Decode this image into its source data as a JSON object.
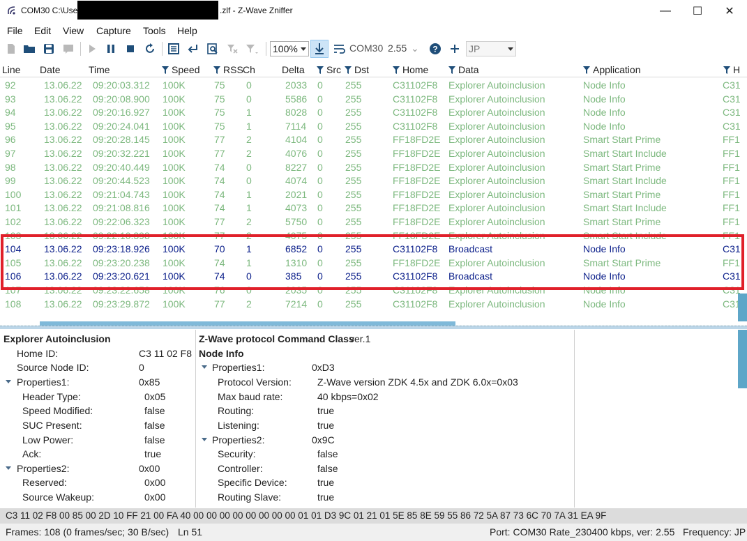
{
  "window": {
    "title_prefix": "COM30 C:\\User",
    "title_suffix": ".zlf - Z-Wave Zniffer",
    "minimize": "—",
    "maximize": "☐",
    "close": "✕"
  },
  "menu": [
    "File",
    "Edit",
    "View",
    "Capture",
    "Tools",
    "Help"
  ],
  "toolbar": {
    "zoom": "100%",
    "port": "COM30",
    "version": "2.55",
    "frequency": "JP",
    "help": "?",
    "add": "+"
  },
  "columns": [
    "Line",
    "Date",
    "Time",
    "Speed",
    "RSS",
    "Ch",
    "Delta",
    "Src",
    "Dst",
    "Home",
    "Data",
    "Application",
    "H"
  ],
  "rows": [
    {
      "line": "92",
      "date": "13.06.22",
      "time": "09:20:03.312",
      "speed": "100K",
      "rss": "75",
      "ch": "0",
      "delta": "2033",
      "src": "0",
      "dst": "255",
      "home": "C31102F8",
      "data": "Explorer Autoinclusion",
      "app": "Node Info",
      "h": "C31",
      "style": "dim"
    },
    {
      "line": "93",
      "date": "13.06.22",
      "time": "09:20:08.900",
      "speed": "100K",
      "rss": "75",
      "ch": "0",
      "delta": "5586",
      "src": "0",
      "dst": "255",
      "home": "C31102F8",
      "data": "Explorer Autoinclusion",
      "app": "Node Info",
      "h": "C31",
      "style": "dim"
    },
    {
      "line": "94",
      "date": "13.06.22",
      "time": "09:20:16.927",
      "speed": "100K",
      "rss": "75",
      "ch": "1",
      "delta": "8028",
      "src": "0",
      "dst": "255",
      "home": "C31102F8",
      "data": "Explorer Autoinclusion",
      "app": "Node Info",
      "h": "C31",
      "style": "dim"
    },
    {
      "line": "95",
      "date": "13.06.22",
      "time": "09:20:24.041",
      "speed": "100K",
      "rss": "75",
      "ch": "1",
      "delta": "7114",
      "src": "0",
      "dst": "255",
      "home": "C31102F8",
      "data": "Explorer Autoinclusion",
      "app": "Node Info",
      "h": "C31",
      "style": "dim"
    },
    {
      "line": "96",
      "date": "13.06.22",
      "time": "09:20:28.145",
      "speed": "100K",
      "rss": "77",
      "ch": "2",
      "delta": "4104",
      "src": "0",
      "dst": "255",
      "home": "FF18FD2E",
      "data": "Explorer Autoinclusion",
      "app": "Smart Start Prime",
      "h": "FF1",
      "style": "dim"
    },
    {
      "line": "97",
      "date": "13.06.22",
      "time": "09:20:32.221",
      "speed": "100K",
      "rss": "77",
      "ch": "2",
      "delta": "4076",
      "src": "0",
      "dst": "255",
      "home": "FF18FD2E",
      "data": "Explorer Autoinclusion",
      "app": "Smart Start Include",
      "h": "FF1",
      "style": "dim"
    },
    {
      "line": "98",
      "date": "13.06.22",
      "time": "09:20:40.449",
      "speed": "100K",
      "rss": "74",
      "ch": "0",
      "delta": "8227",
      "src": "0",
      "dst": "255",
      "home": "FF18FD2E",
      "data": "Explorer Autoinclusion",
      "app": "Smart Start Prime",
      "h": "FF1",
      "style": "dim"
    },
    {
      "line": "99",
      "date": "13.06.22",
      "time": "09:20:44.523",
      "speed": "100K",
      "rss": "74",
      "ch": "0",
      "delta": "4074",
      "src": "0",
      "dst": "255",
      "home": "FF18FD2E",
      "data": "Explorer Autoinclusion",
      "app": "Smart Start Include",
      "h": "FF1",
      "style": "dim"
    },
    {
      "line": "100",
      "date": "13.06.22",
      "time": "09:21:04.743",
      "speed": "100K",
      "rss": "74",
      "ch": "1",
      "delta": "2021",
      "src": "0",
      "dst": "255",
      "home": "FF18FD2E",
      "data": "Explorer Autoinclusion",
      "app": "Smart Start Prime",
      "h": "FF1",
      "style": "dim"
    },
    {
      "line": "101",
      "date": "13.06.22",
      "time": "09:21:08.816",
      "speed": "100K",
      "rss": "74",
      "ch": "1",
      "delta": "4073",
      "src": "0",
      "dst": "255",
      "home": "FF18FD2E",
      "data": "Explorer Autoinclusion",
      "app": "Smart Start Include",
      "h": "FF1",
      "style": "dim"
    },
    {
      "line": "102",
      "date": "13.06.22",
      "time": "09:22:06.323",
      "speed": "100K",
      "rss": "77",
      "ch": "2",
      "delta": "5750",
      "src": "0",
      "dst": "255",
      "home": "FF18FD2E",
      "data": "Explorer Autoinclusion",
      "app": "Smart Start Prime",
      "h": "FF1",
      "style": "dim"
    },
    {
      "line": "103",
      "date": "13.06.22",
      "time": "09:22:10.398",
      "speed": "100K",
      "rss": "77",
      "ch": "2",
      "delta": "4075",
      "src": "0",
      "dst": "255",
      "home": "FF18FD2E",
      "data": "Explorer Autoinclusion",
      "app": "Smart Start Include",
      "h": "FF1",
      "style": "dim"
    },
    {
      "line": "104",
      "date": "13.06.22",
      "time": "09:23:18.926",
      "speed": "100K",
      "rss": "70",
      "ch": "1",
      "delta": "6852",
      "src": "0",
      "dst": "255",
      "home": "C31102F8",
      "data": "Broadcast",
      "app": "Node Info",
      "h": "C31",
      "style": "sel"
    },
    {
      "line": "105",
      "date": "13.06.22",
      "time": "09:23:20.238",
      "speed": "100K",
      "rss": "74",
      "ch": "1",
      "delta": "1310",
      "src": "0",
      "dst": "255",
      "home": "FF18FD2E",
      "data": "Explorer Autoinclusion",
      "app": "Smart Start Prime",
      "h": "FF1",
      "style": "dim"
    },
    {
      "line": "106",
      "date": "13.06.22",
      "time": "09:23:20.621",
      "speed": "100K",
      "rss": "74",
      "ch": "0",
      "delta": "385",
      "src": "0",
      "dst": "255",
      "home": "C31102F8",
      "data": "Broadcast",
      "app": "Node Info",
      "h": "C31",
      "style": "sel"
    },
    {
      "line": "107",
      "date": "13.06.22",
      "time": "09:23:22.658",
      "speed": "100K",
      "rss": "76",
      "ch": "0",
      "delta": "2035",
      "src": "0",
      "dst": "255",
      "home": "C31102F8",
      "data": "Explorer Autoinclusion",
      "app": "Node Info",
      "h": "C31",
      "style": "dim"
    },
    {
      "line": "108",
      "date": "13.06.22",
      "time": "09:23:29.872",
      "speed": "100K",
      "rss": "77",
      "ch": "2",
      "delta": "7214",
      "src": "0",
      "dst": "255",
      "home": "C31102F8",
      "data": "Explorer Autoinclusion",
      "app": "Node Info",
      "h": "C31",
      "style": "dim"
    }
  ],
  "left_pane": {
    "title": "Explorer Autoinclusion",
    "items": [
      {
        "label": "Home ID:",
        "value": "C3 11 02 F8"
      },
      {
        "label": "Source Node ID:",
        "value": "0"
      },
      {
        "label": "Properties1:",
        "value": "0x85"
      },
      {
        "label": "Header Type:",
        "value": "0x05"
      },
      {
        "label": "Speed Modified:",
        "value": "false"
      },
      {
        "label": "SUC Present:",
        "value": "false"
      },
      {
        "label": "Low Power:",
        "value": "false"
      },
      {
        "label": "Ack:",
        "value": "true"
      },
      {
        "label": "Properties2:",
        "value": "0x00"
      },
      {
        "label": "Reserved:",
        "value": "0x00"
      },
      {
        "label": "Source Wakeup:",
        "value": "0x00"
      }
    ]
  },
  "right_pane": {
    "title": "Z-Wave protocol Command Class",
    "ver": "ver.1",
    "subtitle": "Node Info",
    "items": [
      {
        "label": "Properties1:",
        "value": "0xD3"
      },
      {
        "label": "Protocol Version:",
        "value": "Z-Wave version ZDK 4.5x and ZDK 6.0x=0x03"
      },
      {
        "label": "Max baud rate:",
        "value": "40 kbps=0x02"
      },
      {
        "label": "Routing:",
        "value": "true"
      },
      {
        "label": "Listening:",
        "value": "true"
      },
      {
        "label": "Properties2:",
        "value": "0x9C"
      },
      {
        "label": "Security:",
        "value": "false"
      },
      {
        "label": "Controller:",
        "value": "false"
      },
      {
        "label": "Specific Device:",
        "value": "true"
      },
      {
        "label": "Routing Slave:",
        "value": "true"
      }
    ]
  },
  "hex": "C3 11 02 F8 00 85 00 2D 10 FF 21 00 FA 40 00 00 00 00 00 00 00 00 01 01 D3 9C 01 21 01 5E 85 8E 59 55 86 72 5A 87 73 6C 70 7A 31 EA 9F",
  "status": {
    "frames": "Frames: 108 (0 frames/sec; 30 B/sec)",
    "ln": "Ln 51",
    "port": "Port: COM30 Rate_230400 kbps, ver: 2.55",
    "frequency": "Frequency: JP"
  }
}
